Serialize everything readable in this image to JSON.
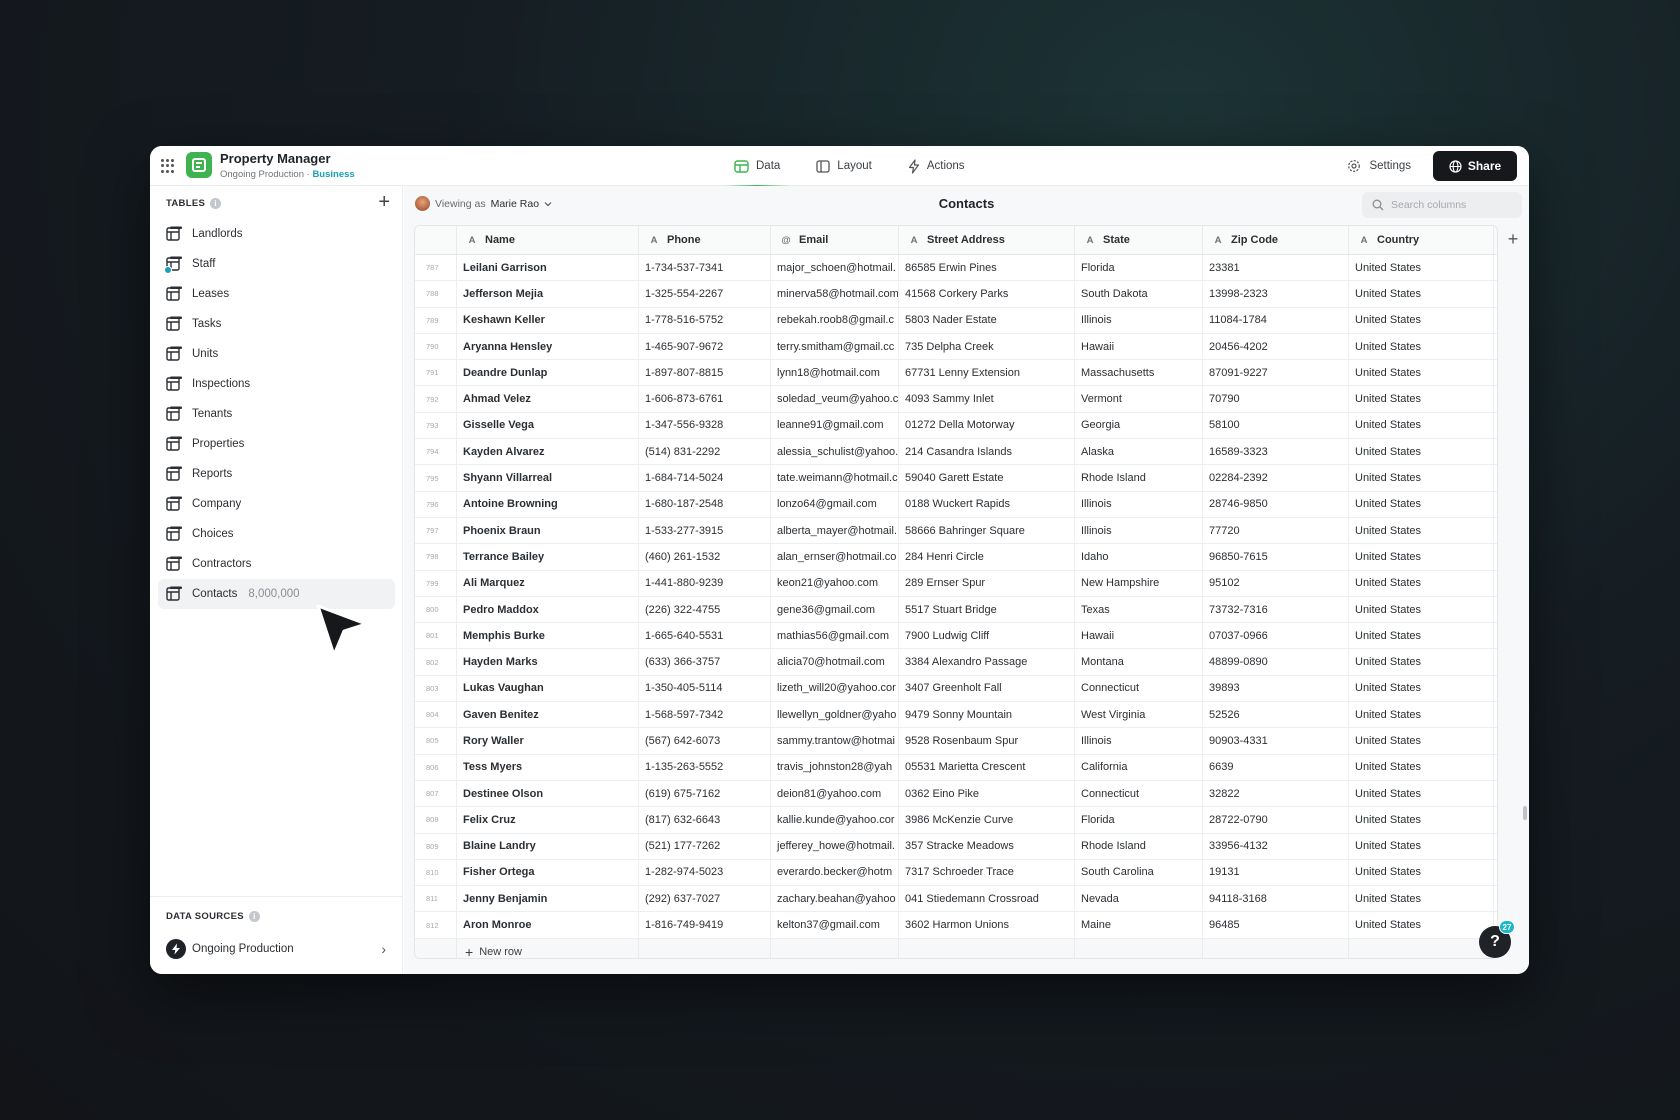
{
  "app": {
    "title": "Property Manager",
    "subtitle_env": "Ongoing Production",
    "subtitle_sep": " · ",
    "plan": "Business",
    "brand_color": "#3fb34f"
  },
  "nav": {
    "data": "Data",
    "layout": "Layout",
    "actions": "Actions"
  },
  "header": {
    "settings": "Settings",
    "share": "Share"
  },
  "sidebar": {
    "tables_heading": "TABLES",
    "items": [
      {
        "label": "Landlords"
      },
      {
        "label": "Staff"
      },
      {
        "label": "Leases"
      },
      {
        "label": "Tasks"
      },
      {
        "label": "Units"
      },
      {
        "label": "Inspections"
      },
      {
        "label": "Tenants"
      },
      {
        "label": "Properties"
      },
      {
        "label": "Reports"
      },
      {
        "label": "Company"
      },
      {
        "label": "Choices"
      },
      {
        "label": "Contractors"
      },
      {
        "label": "Contacts",
        "count": "8,000,000"
      }
    ],
    "data_sources_heading": "DATA SOURCES",
    "data_source": "Ongoing Production"
  },
  "main": {
    "viewing_prefix": "Viewing as",
    "viewing_user": "Marie Rao",
    "title": "Contacts",
    "search_placeholder": "Search columns",
    "columns": [
      "Name",
      "Phone",
      "Email",
      "Street Address",
      "State",
      "Zip Code",
      "Country"
    ],
    "column_types": [
      "A",
      "A",
      "@",
      "A",
      "A",
      "A",
      "A"
    ],
    "rows": [
      [
        "787",
        "Leilani Garrison",
        "1-734-537-7341",
        "major_schoen@hotmail.",
        "86585 Erwin Pines",
        "Florida",
        "23381",
        "United States"
      ],
      [
        "788",
        "Jefferson Mejia",
        "1-325-554-2267",
        "minerva58@hotmail.com",
        "41568 Corkery Parks",
        "South Dakota",
        "13998-2323",
        "United States"
      ],
      [
        "789",
        "Keshawn Keller",
        "1-778-516-5752",
        "rebekah.roob8@gmail.c",
        "5803 Nader Estate",
        "Illinois",
        "11084-1784",
        "United States"
      ],
      [
        "790",
        "Aryanna Hensley",
        "1-465-907-9672",
        "terry.smitham@gmail.cc",
        "735 Delpha Creek",
        "Hawaii",
        "20456-4202",
        "United States"
      ],
      [
        "791",
        "Deandre Dunlap",
        "1-897-807-8815",
        "lynn18@hotmail.com",
        "67731 Lenny Extension",
        "Massachusetts",
        "87091-9227",
        "United States"
      ],
      [
        "792",
        "Ahmad Velez",
        "1-606-873-6761",
        "soledad_veum@yahoo.c",
        "4093 Sammy Inlet",
        "Vermont",
        "70790",
        "United States"
      ],
      [
        "793",
        "Gisselle Vega",
        "1-347-556-9328",
        "leanne91@gmail.com",
        "01272 Della Motorway",
        "Georgia",
        "58100",
        "United States"
      ],
      [
        "794",
        "Kayden Alvarez",
        "(514) 831-2292",
        "alessia_schulist@yahoo.",
        "214 Casandra Islands",
        "Alaska",
        "16589-3323",
        "United States"
      ],
      [
        "795",
        "Shyann Villarreal",
        "1-684-714-5024",
        "tate.weimann@hotmail.c",
        "59040 Garett Estate",
        "Rhode Island",
        "02284-2392",
        "United States"
      ],
      [
        "796",
        "Antoine Browning",
        "1-680-187-2548",
        "lonzo64@gmail.com",
        "0188 Wuckert Rapids",
        "Illinois",
        "28746-9850",
        "United States"
      ],
      [
        "797",
        "Phoenix Braun",
        "1-533-277-3915",
        "alberta_mayer@hotmail.",
        "58666 Bahringer Square",
        "Illinois",
        "77720",
        "United States"
      ],
      [
        "798",
        "Terrance Bailey",
        "(460) 261-1532",
        "alan_ernser@hotmail.co",
        "284 Henri Circle",
        "Idaho",
        "96850-7615",
        "United States"
      ],
      [
        "799",
        "Ali Marquez",
        "1-441-880-9239",
        "keon21@yahoo.com",
        "289 Ernser Spur",
        "New Hampshire",
        "95102",
        "United States"
      ],
      [
        "800",
        "Pedro Maddox",
        "(226) 322-4755",
        "gene36@gmail.com",
        "5517 Stuart Bridge",
        "Texas",
        "73732-7316",
        "United States"
      ],
      [
        "801",
        "Memphis Burke",
        "1-665-640-5531",
        "mathias56@gmail.com",
        "7900 Ludwig Cliff",
        "Hawaii",
        "07037-0966",
        "United States"
      ],
      [
        "802",
        "Hayden Marks",
        "(633) 366-3757",
        "alicia70@hotmail.com",
        "3384 Alexandro Passage",
        "Montana",
        "48899-0890",
        "United States"
      ],
      [
        "803",
        "Lukas Vaughan",
        "1-350-405-5114",
        "lizeth_will20@yahoo.cor",
        "3407 Greenholt Fall",
        "Connecticut",
        "39893",
        "United States"
      ],
      [
        "804",
        "Gaven Benitez",
        "1-568-597-7342",
        "llewellyn_goldner@yaho",
        "9479 Sonny Mountain",
        "West Virginia",
        "52526",
        "United States"
      ],
      [
        "805",
        "Rory Waller",
        "(567) 642-6073",
        "sammy.trantow@hotmai",
        "9528 Rosenbaum Spur",
        "Illinois",
        "90903-4331",
        "United States"
      ],
      [
        "806",
        "Tess Myers",
        "1-135-263-5552",
        "travis_johnston28@yah",
        "05531 Marietta Crescent",
        "California",
        "6639",
        "United States"
      ],
      [
        "807",
        "Destinee Olson",
        "(619) 675-7162",
        "deion81@yahoo.com",
        "0362 Eino Pike",
        "Connecticut",
        "32822",
        "United States"
      ],
      [
        "808",
        "Felix Cruz",
        "(817) 632-6643",
        "kallie.kunde@yahoo.cor",
        "3986 McKenzie Curve",
        "Florida",
        "28722-0790",
        "United States"
      ],
      [
        "809",
        "Blaine Landry",
        "(521) 177-7262",
        "jefferey_howe@hotmail.",
        "357 Stracke Meadows",
        "Rhode Island",
        "33956-4132",
        "United States"
      ],
      [
        "810",
        "Fisher Ortega",
        "1-282-974-5023",
        "everardo.becker@hotm",
        "7317 Schroeder Trace",
        "South Carolina",
        "19131",
        "United States"
      ],
      [
        "811",
        "Jenny Benjamin",
        "(292) 637-7027",
        "zachary.beahan@yahoo",
        "041 Stiedemann Crossroad",
        "Nevada",
        "94118-3168",
        "United States"
      ],
      [
        "812",
        "Aron Monroe",
        "1-816-749-9419",
        "kelton37@gmail.com",
        "3602 Harmon Unions",
        "Maine",
        "96485",
        "United States"
      ]
    ],
    "new_row": "New row",
    "help_label": "?",
    "help_badge": "27"
  }
}
